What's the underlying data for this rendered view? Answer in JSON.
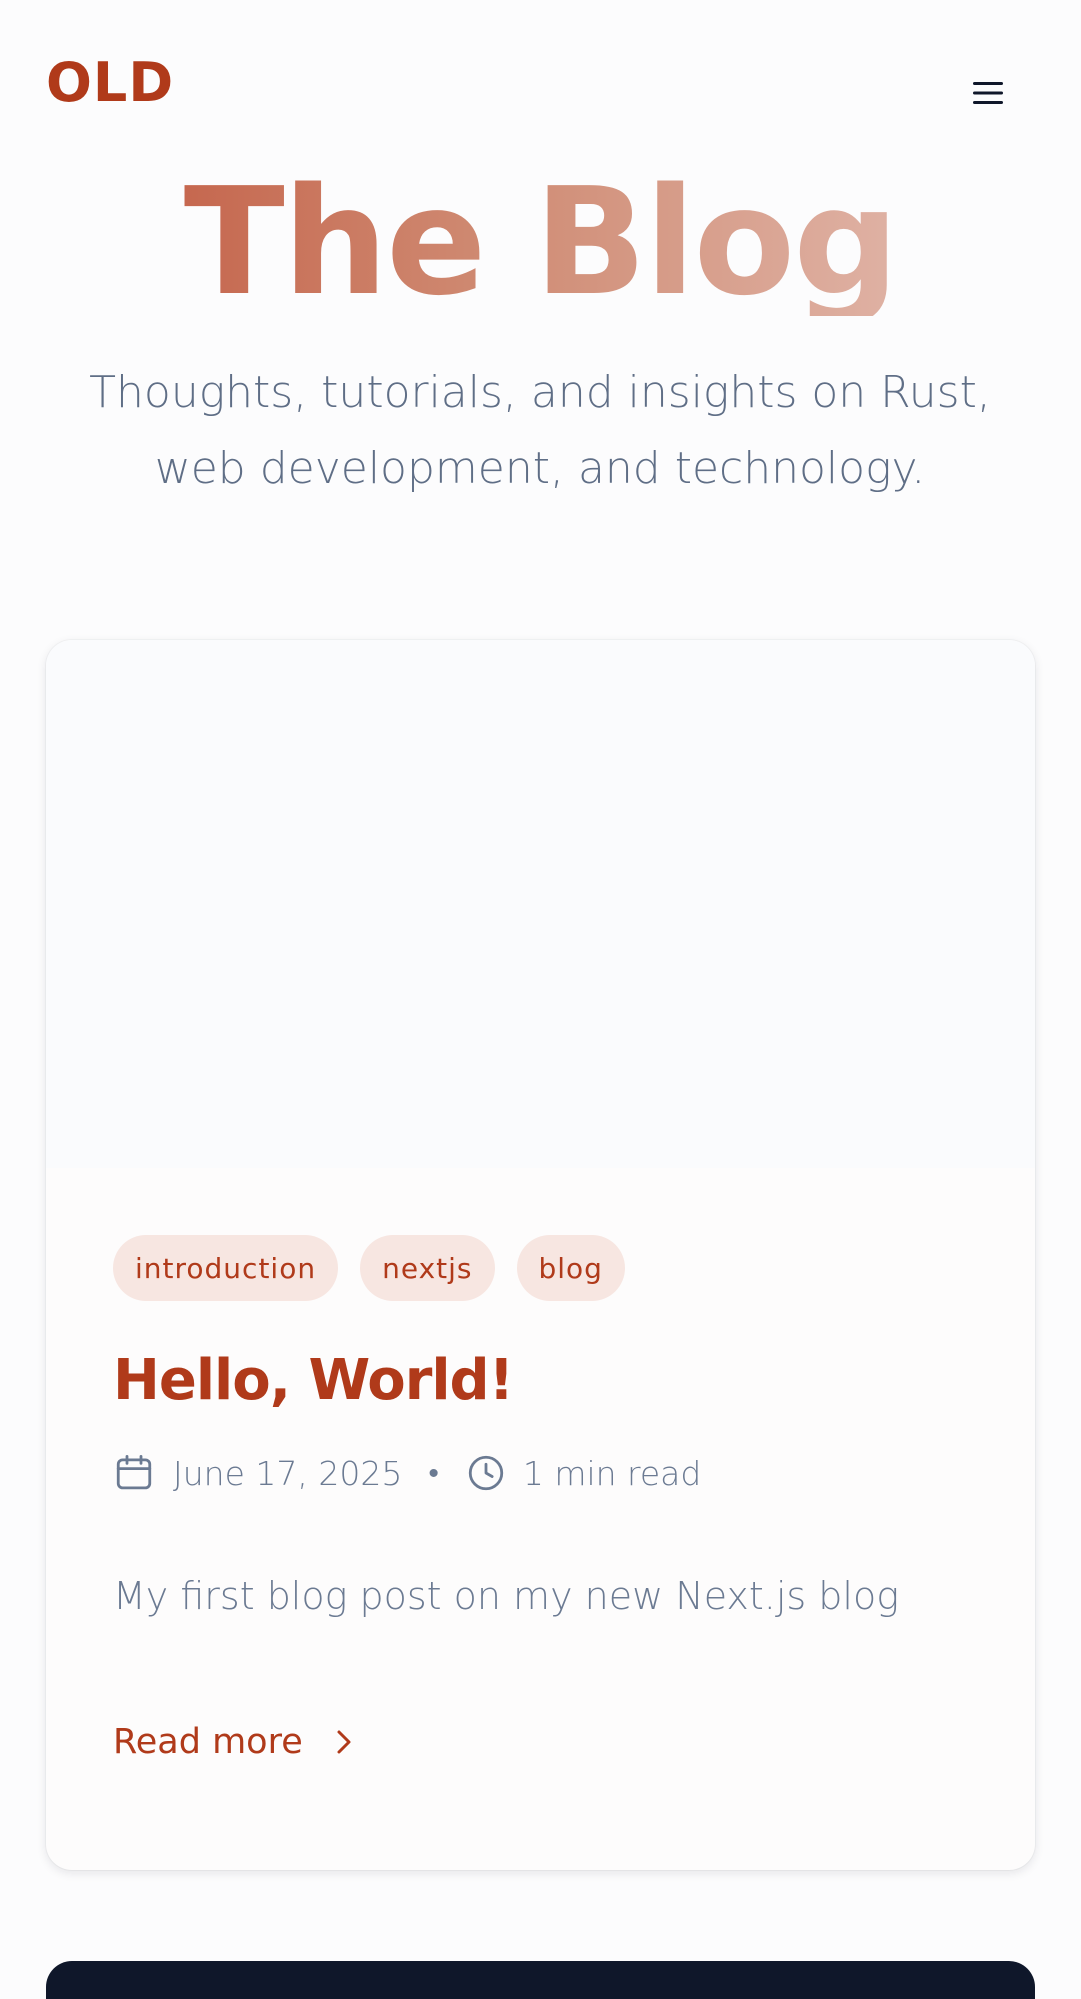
{
  "header": {
    "logo": "OLD",
    "menu_icon": "hamburger-menu-icon"
  },
  "hero": {
    "title": "The Blog",
    "subtitle": "Thoughts, tutorials, and insights on Rust, web development, and technology."
  },
  "posts": [
    {
      "tags": [
        "introduction",
        "nextjs",
        "blog"
      ],
      "title": "Hello, World!",
      "date": "June 17, 2025",
      "read_time": "1 min read",
      "separator": "•",
      "excerpt": "My first blog post on my new Next.js blog",
      "read_more": "Read more",
      "icons": {
        "date": "calendar-icon",
        "read_time": "clock-icon",
        "read_more": "chevron-right-icon"
      }
    }
  ],
  "colors": {
    "brand": "#b03a1a",
    "text_muted": "#5f6e86",
    "tag_bg": "#f7e6e1",
    "footer_bg": "#0f172a",
    "title_gradient_start": "#c0533a",
    "title_gradient_end": "#e6c3ba"
  }
}
